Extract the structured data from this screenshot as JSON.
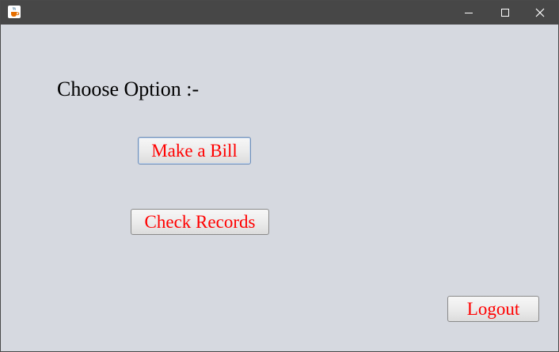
{
  "window": {
    "app_icon": "java-cup-icon",
    "controls": {
      "minimize_icon": "minimize-icon",
      "maximize_icon": "maximize-icon",
      "close_icon": "close-icon"
    }
  },
  "main": {
    "heading": "Choose Option :-",
    "make_bill_label": "Make a Bill",
    "check_records_label": "Check Records",
    "logout_label": "Logout"
  },
  "colors": {
    "button_text": "#ff0000",
    "background": "#d6d9e0",
    "titlebar": "#474747"
  }
}
